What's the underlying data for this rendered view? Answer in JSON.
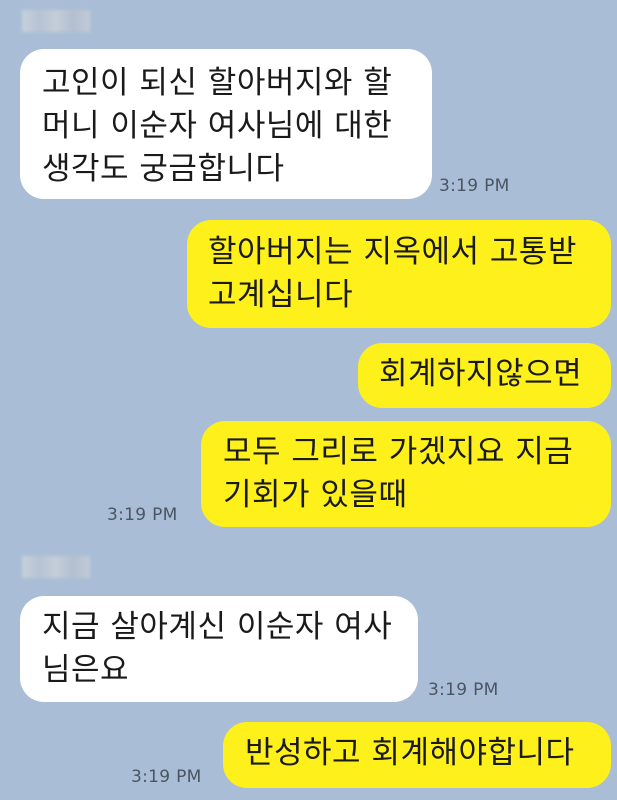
{
  "messages": [
    {
      "sender": "other",
      "lines": [
        "고인이 되신 할아버지와 할",
        "머니 이순자 여사님에 대한",
        "생각도 궁금합니다"
      ],
      "time": "3:19 PM"
    },
    {
      "sender": "me",
      "lines": [
        "할아버지는 지옥에서 고통받",
        "고계십니다"
      ]
    },
    {
      "sender": "me",
      "lines": [
        "회계하지않으면"
      ]
    },
    {
      "sender": "me",
      "lines": [
        "모두 그리로 가겠지요 지금",
        "기회가 있을때"
      ],
      "time": "3:19 PM"
    },
    {
      "sender": "other",
      "lines": [
        "지금 살아계신 이순자 여사",
        "님은요"
      ],
      "time": "3:19 PM"
    },
    {
      "sender": "me",
      "lines": [
        "반성하고 회계해야합니다"
      ],
      "time": "3:19 PM"
    }
  ],
  "colors": {
    "background": "#a9bed6",
    "other_bubble": "#ffffff",
    "my_bubble": "#fef01b",
    "time_text": "#4a5563"
  }
}
